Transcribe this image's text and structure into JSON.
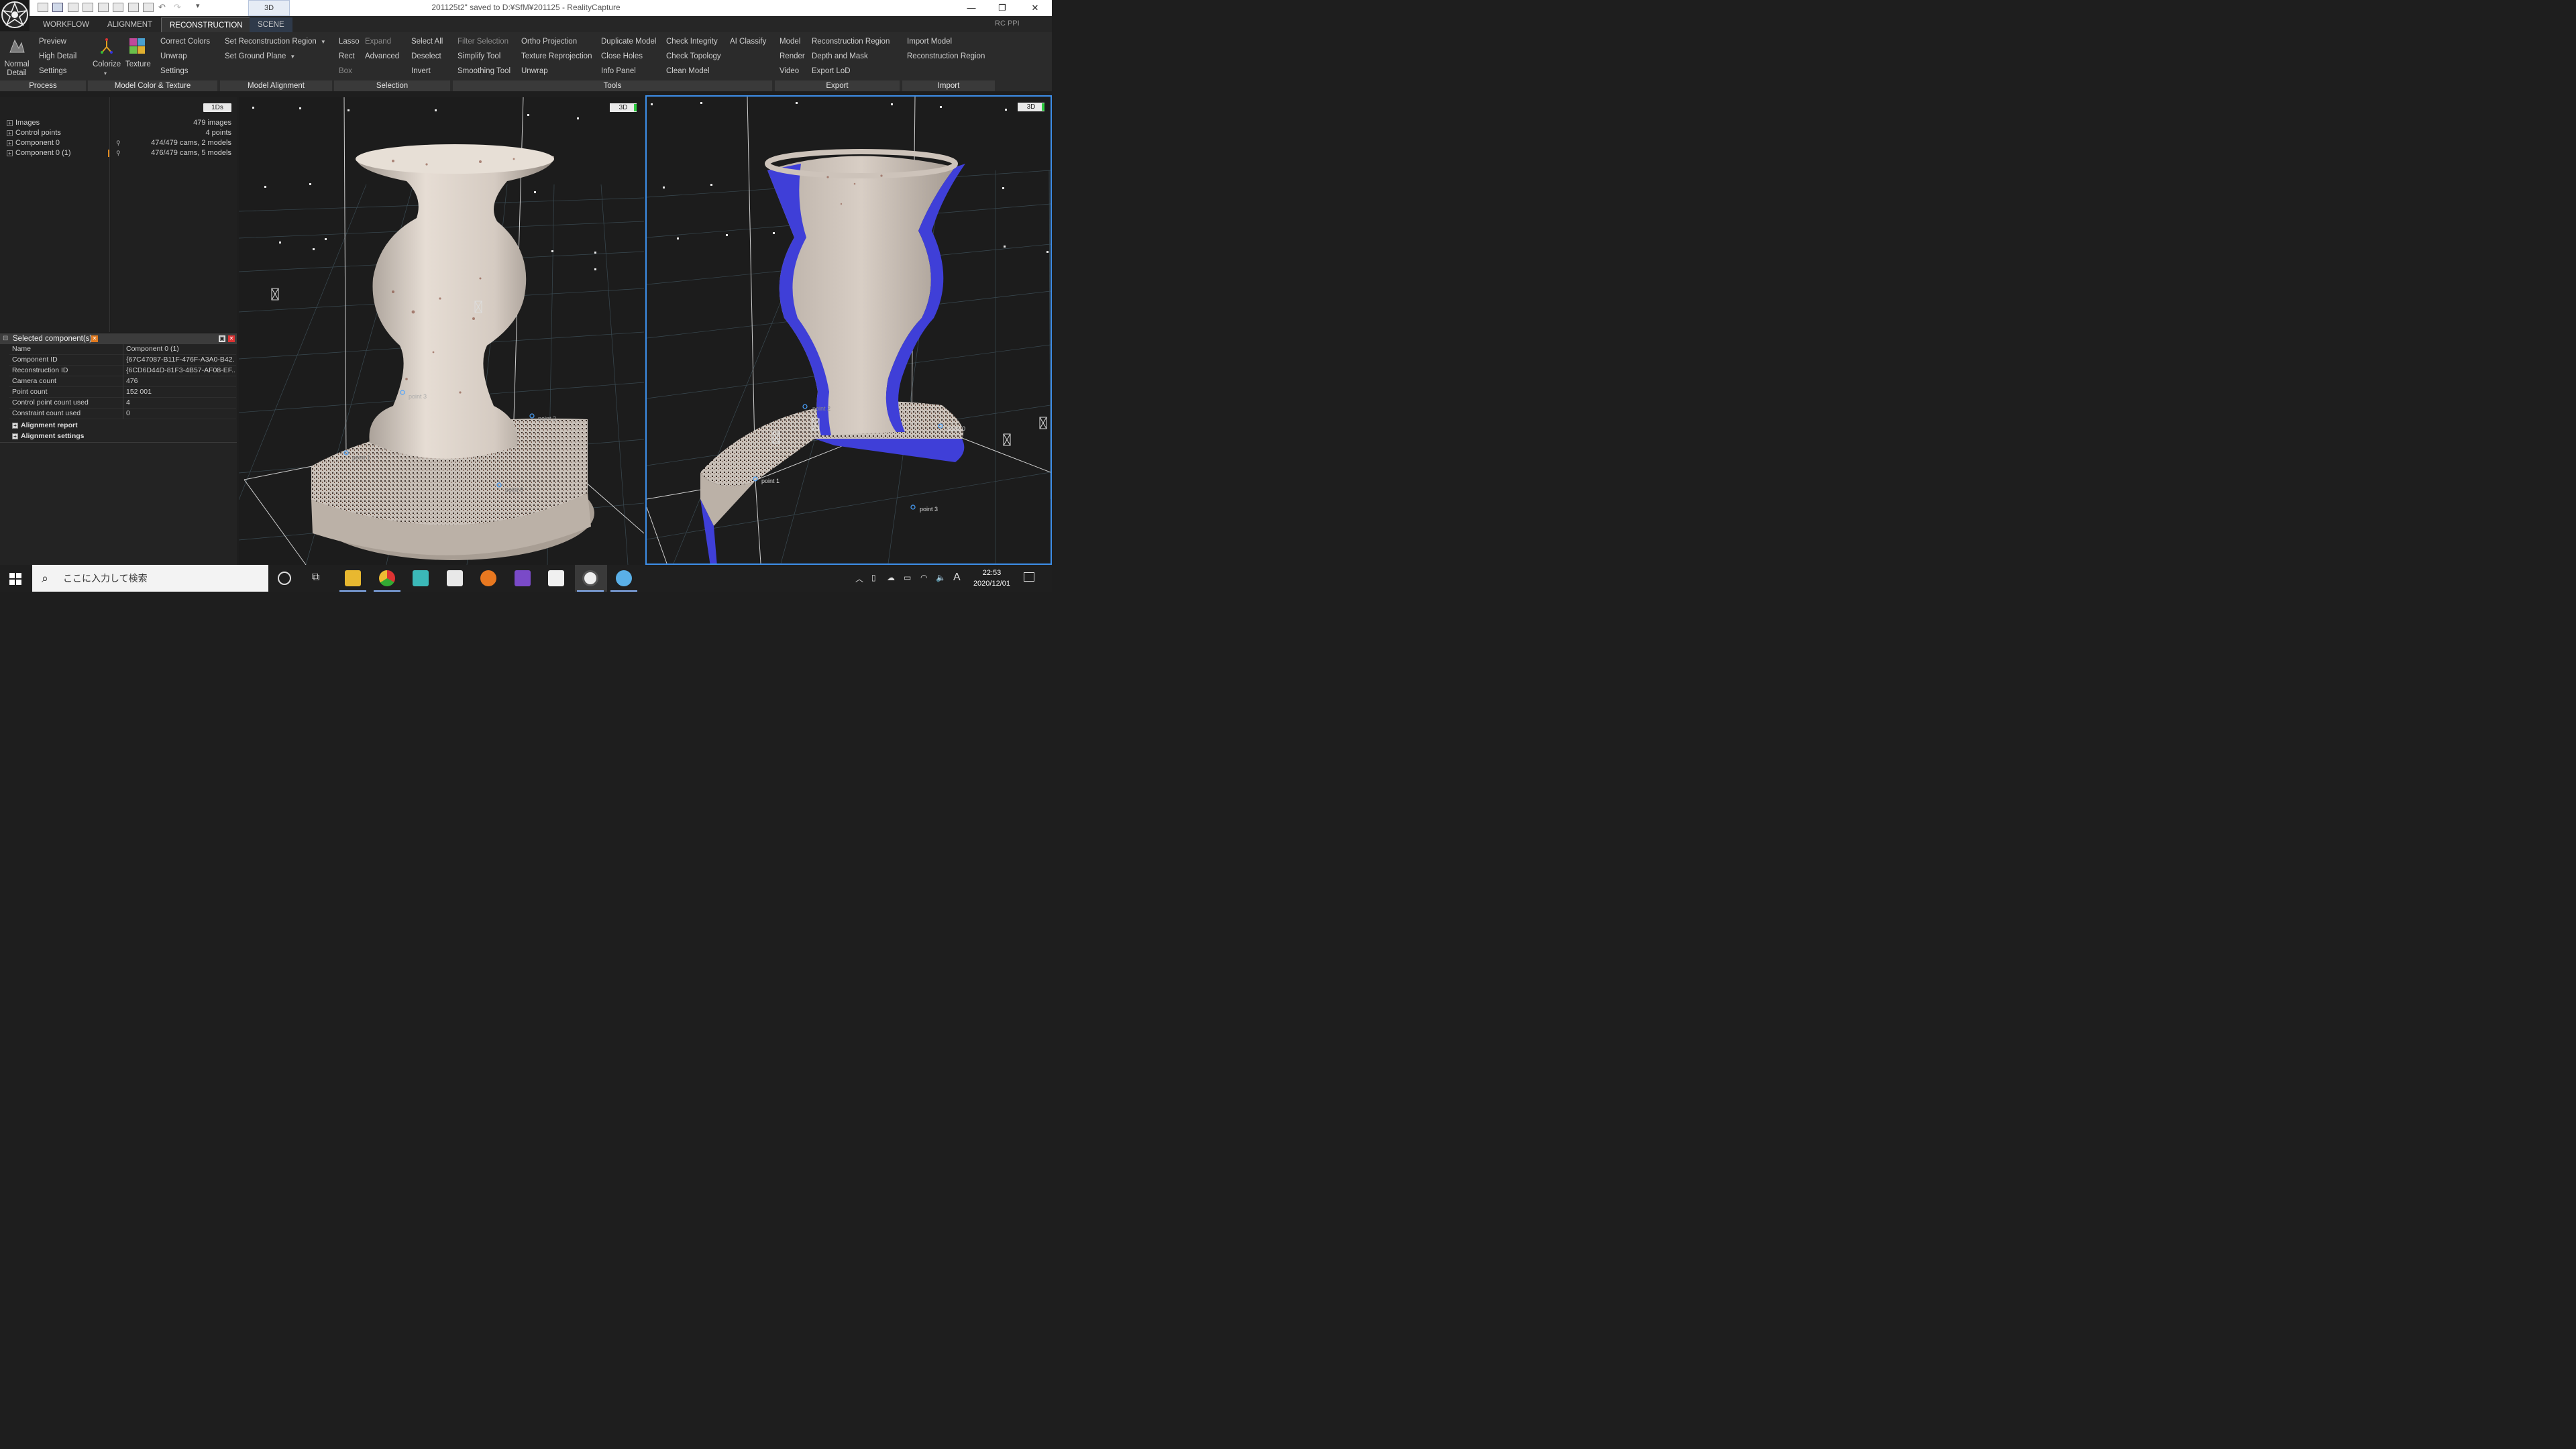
{
  "window": {
    "title": "201125t2\" saved to D:¥SfM¥201125 - RealityCapture",
    "view_tab": "3D",
    "controls": [
      "—",
      "❐",
      "✕"
    ]
  },
  "menu": {
    "tabs": [
      "WORKFLOW",
      "ALIGNMENT",
      "RECONSTRUCTION",
      "SCENE"
    ],
    "active": "RECONSTRUCTION",
    "right": "RC PPI"
  },
  "ribbon": {
    "process": {
      "big": "Normal Detail",
      "big_line1": "Normal",
      "big_line2": "Detail",
      "items": [
        "Preview",
        "High Detail",
        "Settings"
      ],
      "label": "Process"
    },
    "color_texture": {
      "colorize": "Colorize",
      "texture": "Texture",
      "items": [
        "Correct Colors",
        "Unwrap",
        "Settings"
      ],
      "label": "Model Color & Texture"
    },
    "alignment": {
      "items": [
        "Set Reconstruction Region",
        "Set Ground Plane"
      ],
      "label": "Model Alignment"
    },
    "selection": {
      "col1": [
        "Lasso",
        "Rect",
        "Box"
      ],
      "col2": [
        "Expand",
        "Advanced"
      ],
      "col3": [
        "Select All",
        "Deselect",
        "Invert"
      ],
      "label": "Selection"
    },
    "tools": {
      "col1": [
        "Filter Selection",
        "Simplify Tool",
        "Smoothing Tool"
      ],
      "col2": [
        "Ortho Projection",
        "Texture Reprojection",
        "Unwrap"
      ],
      "col3": [
        "Duplicate Model",
        "Close Holes",
        "Info Panel"
      ],
      "col4": [
        "Check Integrity",
        "Check Topology",
        "Clean Model"
      ],
      "col5": [
        "AI Classify"
      ],
      "label": "Tools"
    },
    "export": {
      "col1": [
        "Model",
        "Render",
        "Video"
      ],
      "col2": [
        "Reconstruction Region",
        "Depth and Mask",
        "Export LoD"
      ],
      "label": "Export"
    },
    "import": {
      "items": [
        "Import Model",
        "Reconstruction Region"
      ],
      "label": "Import"
    }
  },
  "tree": {
    "badge": "1Ds",
    "rows": [
      {
        "label": "Images",
        "value": "479 images"
      },
      {
        "label": "Control points",
        "value": "4 points"
      },
      {
        "label": "Component 0",
        "value": "474/479 cams, 2 models"
      },
      {
        "label": "Component 0 (1)",
        "value": "476/479 cams, 5 models"
      }
    ]
  },
  "properties": {
    "header": "Selected component(s)",
    "rows": [
      {
        "key": "Name",
        "value": "Component 0 (1)"
      },
      {
        "key": "Component ID",
        "value": "{67C47087-B11F-476F-A3A0-B42..."
      },
      {
        "key": "Reconstruction ID",
        "value": "{6CD6D44D-81F3-4B57-AF08-EF..."
      },
      {
        "key": "Camera count",
        "value": "476"
      },
      {
        "key": "Point count",
        "value": "152 001"
      },
      {
        "key": "Control point count used",
        "value": "4"
      },
      {
        "key": "Constraint count used",
        "value": "0"
      }
    ],
    "sections": [
      "Alignment report",
      "Alignment settings"
    ]
  },
  "viewport_left": {
    "badge": "3D",
    "points": [
      "point 3",
      "point 2",
      "point 1",
      "point 0"
    ]
  },
  "viewport_right": {
    "badge": "3D",
    "points": [
      "point 2",
      "point 0",
      "point 1",
      "point 3"
    ]
  },
  "colors": {
    "accent": "#4a90e2",
    "cut_surface": "#3f3fd8",
    "vase": "#d9cfc6",
    "active_border": "#3d8ee8"
  },
  "taskbar": {
    "search_placeholder": "ここに入力して検索",
    "apps": [
      "cortana-icon",
      "task-view-icon",
      "file-explorer-icon",
      "chrome-icon",
      "miku-icon",
      "unity-icon",
      "blender-icon",
      "visual-studio-icon",
      "neural-network-console-icon",
      "realitycapture-icon",
      "paint-icon"
    ],
    "ime": "A",
    "time": "22:53",
    "date": "2020/12/01"
  }
}
